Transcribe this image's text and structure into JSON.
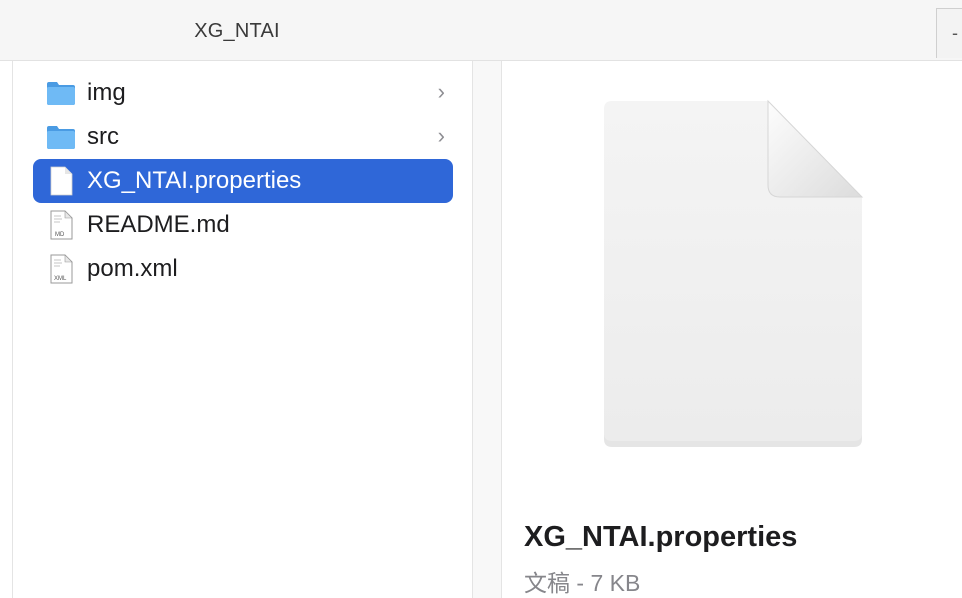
{
  "window": {
    "title": "XG_NTAI",
    "corner_control": "-"
  },
  "list": {
    "items": [
      {
        "label": "img",
        "icon": "folder-icon",
        "has_chevron": true,
        "selected": false
      },
      {
        "label": "src",
        "icon": "folder-icon",
        "has_chevron": true,
        "selected": false
      },
      {
        "label": "XG_NTAI.properties",
        "icon": "blank-document-icon",
        "has_chevron": false,
        "selected": true
      },
      {
        "label": "README.md",
        "icon": "md-document-icon",
        "icon_badge": "MD",
        "has_chevron": false,
        "selected": false
      },
      {
        "label": "pom.xml",
        "icon": "xml-document-icon",
        "icon_badge": "XML",
        "has_chevron": false,
        "selected": false
      }
    ],
    "chevron": "›"
  },
  "preview": {
    "file_name": "XG_NTAI.properties",
    "file_meta": "文稿 - 7 KB"
  },
  "colors": {
    "selection": "#2f67d8",
    "folder": "#5aaef0",
    "secondary_text": "#86868b"
  }
}
